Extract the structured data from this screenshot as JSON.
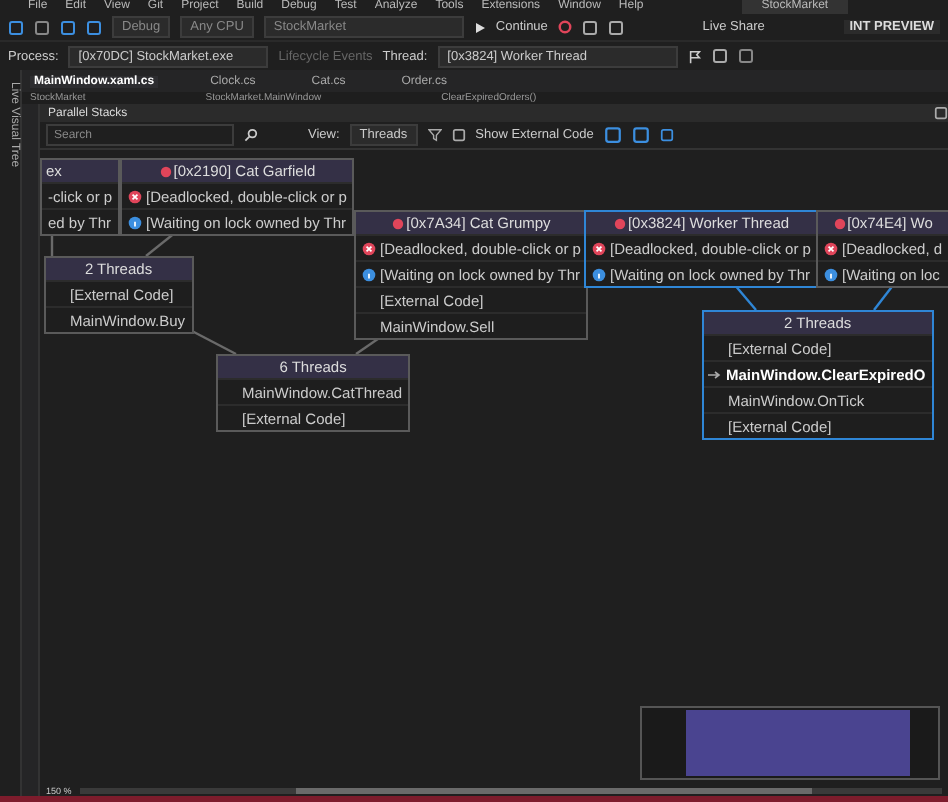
{
  "menu": [
    "File",
    "Edit",
    "View",
    "Git",
    "Project",
    "Build",
    "Debug",
    "Test",
    "Analyze",
    "Tools",
    "Extensions",
    "Window",
    "Help"
  ],
  "solution_name": "StockMarket",
  "toolbar": {
    "configuration": "Debug",
    "platform": "Any CPU",
    "startup_project": "StockMarket",
    "continue": "Continue",
    "live_share": "Live Share",
    "badge": "INT PREVIEW"
  },
  "debug_location": {
    "process_label": "Process:",
    "process": "[0x70DC] StockMarket.exe",
    "lifecycle": "Lifecycle Events",
    "thread_label": "Thread:",
    "thread": "[0x3824] Worker Thread"
  },
  "side_tab": "Live Visual Tree",
  "doc_tabs": [
    {
      "label": "MainWindow.xaml.cs",
      "selected": true
    },
    {
      "label": "Clock.cs",
      "selected": false
    },
    {
      "label": "Cat.cs",
      "selected": false
    },
    {
      "label": "Order.cs",
      "selected": false
    }
  ],
  "nav_bar": [
    "StockMarket",
    "StockMarket.MainWindow",
    "ClearExpiredOrders()"
  ],
  "parallel_stacks": {
    "title": "Parallel Stacks",
    "search": {
      "placeholder": "Search"
    },
    "view_label": "View:",
    "view": "Threads",
    "show_external_code": "Show External Code",
    "zoom": "150 %",
    "nodes": [
      {
        "kind": "group",
        "header": "ex",
        "current": false,
        "rows": [
          {
            "kind": "frame",
            "text": "-click or p",
            "current": false
          },
          {
            "kind": "frame",
            "text": "ed by Thr",
            "current": false
          }
        ]
      },
      {
        "kind": "thread",
        "header": "[0x2190] Cat Garfield",
        "current": false,
        "rows": [
          {
            "kind": "deadlock",
            "text": "[Deadlocked, double-click or p",
            "current": false
          },
          {
            "kind": "waiting",
            "text": "[Waiting on lock owned by Thr",
            "current": false
          }
        ]
      },
      {
        "kind": "group",
        "header": "2 Threads",
        "current": false,
        "rows": [
          {
            "kind": "frame",
            "text": "[External Code]",
            "current": false
          },
          {
            "kind": "frame",
            "text": "MainWindow.Buy",
            "current": false
          }
        ]
      },
      {
        "kind": "group",
        "header": "6 Threads",
        "current": false,
        "rows": [
          {
            "kind": "frame",
            "text": "MainWindow.CatThread",
            "current": false
          },
          {
            "kind": "frame",
            "text": "[External Code]",
            "current": false
          }
        ]
      },
      {
        "kind": "thread",
        "header": "[0x7A34] Cat Grumpy",
        "current": false,
        "rows": [
          {
            "kind": "deadlock",
            "text": "[Deadlocked, double-click or p",
            "current": false
          },
          {
            "kind": "waiting",
            "text": "[Waiting on lock owned by Thr",
            "current": false
          },
          {
            "kind": "frame",
            "text": "[External Code]",
            "current": false
          },
          {
            "kind": "frame",
            "text": "MainWindow.Sell",
            "current": false
          }
        ]
      },
      {
        "kind": "thread",
        "header": "[0x3824] Worker Thread",
        "current": true,
        "rows": [
          {
            "kind": "deadlock",
            "text": "[Deadlocked, double-click or p",
            "current": false
          },
          {
            "kind": "waiting",
            "text": "[Waiting on lock owned by Thr",
            "current": false
          }
        ]
      },
      {
        "kind": "thread",
        "header": "[0x74E4] Wo",
        "current": false,
        "rows": [
          {
            "kind": "deadlock",
            "text": "[Deadlocked, d",
            "current": false
          },
          {
            "kind": "waiting",
            "text": "[Waiting on loc",
            "current": false
          }
        ]
      },
      {
        "kind": "group",
        "header": "2 Threads",
        "current": true,
        "rows": [
          {
            "kind": "frame",
            "text": "[External Code]",
            "current": false
          },
          {
            "kind": "frame",
            "text": "MainWindow.ClearExpiredO",
            "current": true
          },
          {
            "kind": "frame",
            "text": "MainWindow.OnTick",
            "current": false
          },
          {
            "kind": "frame",
            "text": "[External Code]",
            "current": false
          }
        ]
      }
    ]
  }
}
